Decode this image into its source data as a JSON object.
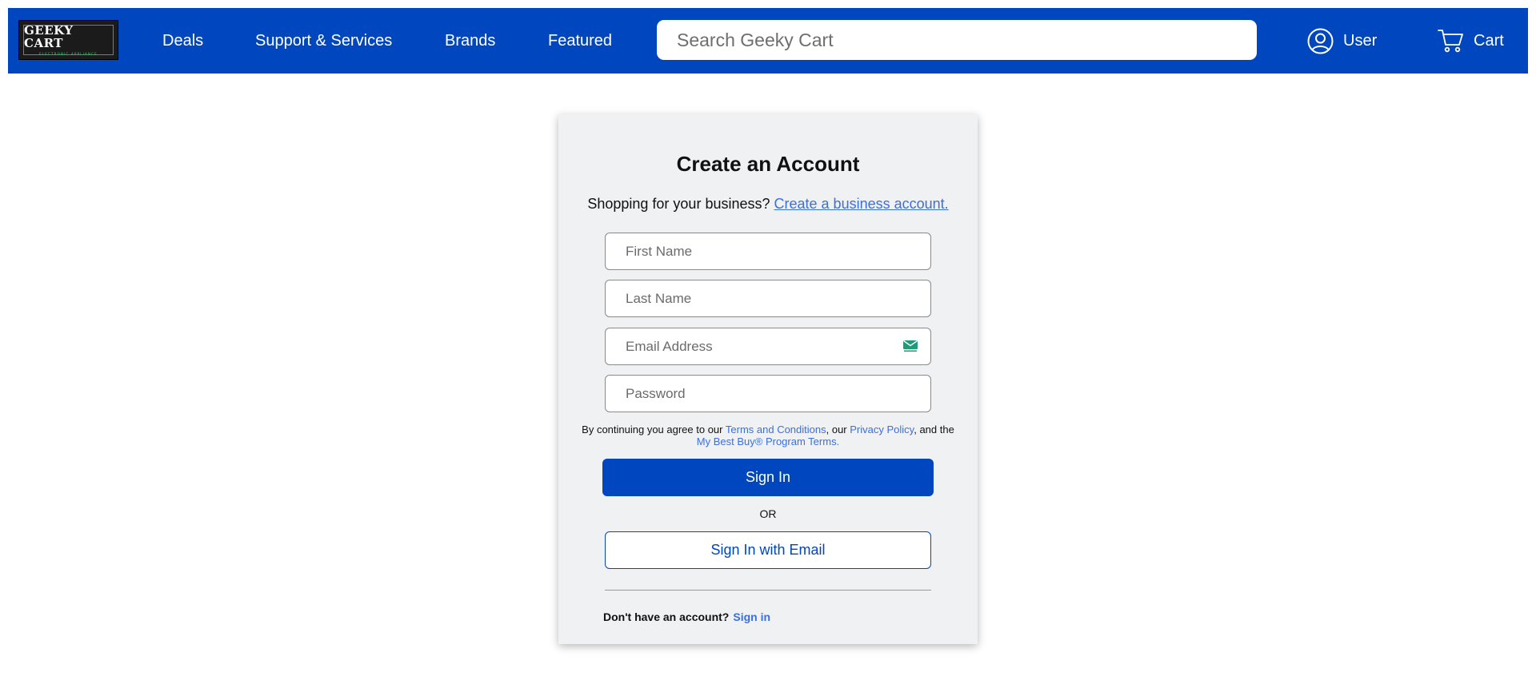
{
  "colors": {
    "nav_bg": "#0046be",
    "primary": "#0046be",
    "link": "#3b6fe0",
    "card_bg": "#f0f1f3"
  },
  "logo": {
    "title": "GEEKY CART",
    "subtitle": "ELECTRONIC APPLIANCE"
  },
  "nav": {
    "links": [
      "Deals",
      "Support & Services",
      "Brands",
      "Featured"
    ],
    "search_placeholder": "Search Geeky Cart",
    "user_label": "User",
    "user_icon": "user-circle-icon",
    "cart_label": "Cart",
    "cart_icon": "cart-icon"
  },
  "form": {
    "title": "Create an Account",
    "business_prompt": "Shopping for your business?",
    "business_link": "Create a business account.",
    "first_name_placeholder": "First Name",
    "last_name_placeholder": "Last Name",
    "email_placeholder": "Email Address",
    "email_badge_icon": "mail-icon",
    "password_placeholder": "Password",
    "terms": {
      "prefix": "By continuing you agree to our",
      "terms_link": "Terms and Conditions",
      "middle": ", our",
      "privacy_link": "Privacy Policy",
      "and": ", and the",
      "program_link": "My Best Buy® Program Terms."
    },
    "sign_in_button": "Sign In",
    "or_text": "OR",
    "email_sign_in_button": "Sign In with Email",
    "no_account_text": "Don't have an account?",
    "sign_in_link": "Sign in"
  }
}
